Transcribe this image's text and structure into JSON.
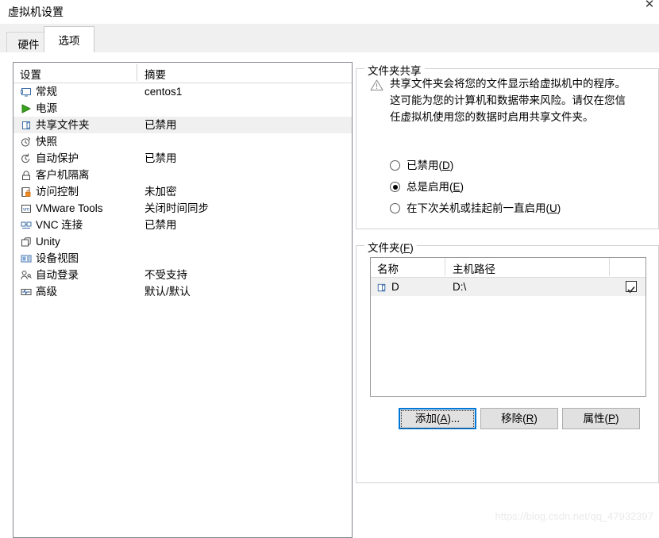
{
  "window": {
    "title": "虚拟机设置",
    "close_label": "✕"
  },
  "tabs": [
    {
      "label": "硬件",
      "active": false
    },
    {
      "label": "选项",
      "active": true
    }
  ],
  "settings_list": {
    "columns": {
      "name": "设置",
      "summary": "摘要"
    },
    "rows": [
      {
        "icon": "monitor-icon",
        "label": "常规",
        "summary": "centos1",
        "selected": false
      },
      {
        "icon": "power-play-icon",
        "label": "电源",
        "summary": "",
        "selected": false
      },
      {
        "icon": "shared-folder-icon",
        "label": "共享文件夹",
        "summary": "已禁用",
        "selected": true
      },
      {
        "icon": "snapshot-clock-icon",
        "label": "快照",
        "summary": "",
        "selected": false
      },
      {
        "icon": "autoprotect-icon",
        "label": "自动保护",
        "summary": "已禁用",
        "selected": false
      },
      {
        "icon": "padlock-icon",
        "label": "客户机隔离",
        "summary": "",
        "selected": false
      },
      {
        "icon": "access-control-icon",
        "label": "访问控制",
        "summary": "未加密",
        "selected": false
      },
      {
        "icon": "vmware-tools-icon",
        "label": "VMware Tools",
        "summary": "关闭时间同步",
        "selected": false
      },
      {
        "icon": "vnc-icon",
        "label": "VNC 连接",
        "summary": "已禁用",
        "selected": false
      },
      {
        "icon": "unity-icon",
        "label": "Unity",
        "summary": "",
        "selected": false
      },
      {
        "icon": "device-view-icon",
        "label": "设备视图",
        "summary": "",
        "selected": false
      },
      {
        "icon": "auto-login-icon",
        "label": "自动登录",
        "summary": "不受支持",
        "selected": false
      },
      {
        "icon": "advanced-icon",
        "label": "高级",
        "summary": "默认/默认",
        "selected": false
      }
    ]
  },
  "sharing": {
    "group_title": "文件夹共享",
    "warning_icon": "warning-triangle-icon",
    "warning_text": "共享文件夹会将您的文件显示给虚拟机中的程序。这可能为您的计算机和数据带来风险。请仅在您信任虚拟机使用您的数据时启用共享文件夹。",
    "options": [
      {
        "label": "已禁用",
        "accesskey": "D",
        "selected": false
      },
      {
        "label": "总是启用",
        "accesskey": "E",
        "selected": true
      },
      {
        "label": "在下次关机或挂起前一直启用",
        "accesskey": "U",
        "selected": false
      }
    ]
  },
  "folders": {
    "group_title": "文件夹",
    "group_accesskey": "F",
    "columns": {
      "name": "名称",
      "path": "主机路径",
      "enabled": ""
    },
    "rows": [
      {
        "icon": "folder-icon",
        "name": "D",
        "path": "D:\\",
        "enabled": true
      }
    ],
    "buttons": [
      {
        "id": "add",
        "label": "添加",
        "accesskey": "A",
        "suffix": "...",
        "focused": true
      },
      {
        "id": "remove",
        "label": "移除",
        "accesskey": "R",
        "suffix": "",
        "focused": false
      },
      {
        "id": "properties",
        "label": "属性",
        "accesskey": "P",
        "suffix": "",
        "focused": false
      }
    ]
  },
  "watermark": "https://blog.csdn.net/qq_47932397",
  "colors": {
    "accent": "#0078d7",
    "selection": "#f0f0f0",
    "panel_border": "#828790",
    "group_border": "#d2d2d2",
    "button_face": "#e1e1e1",
    "play_green": "#3aa31e",
    "lock_orange": "#f08a24",
    "vm_blue": "#2a5699"
  }
}
